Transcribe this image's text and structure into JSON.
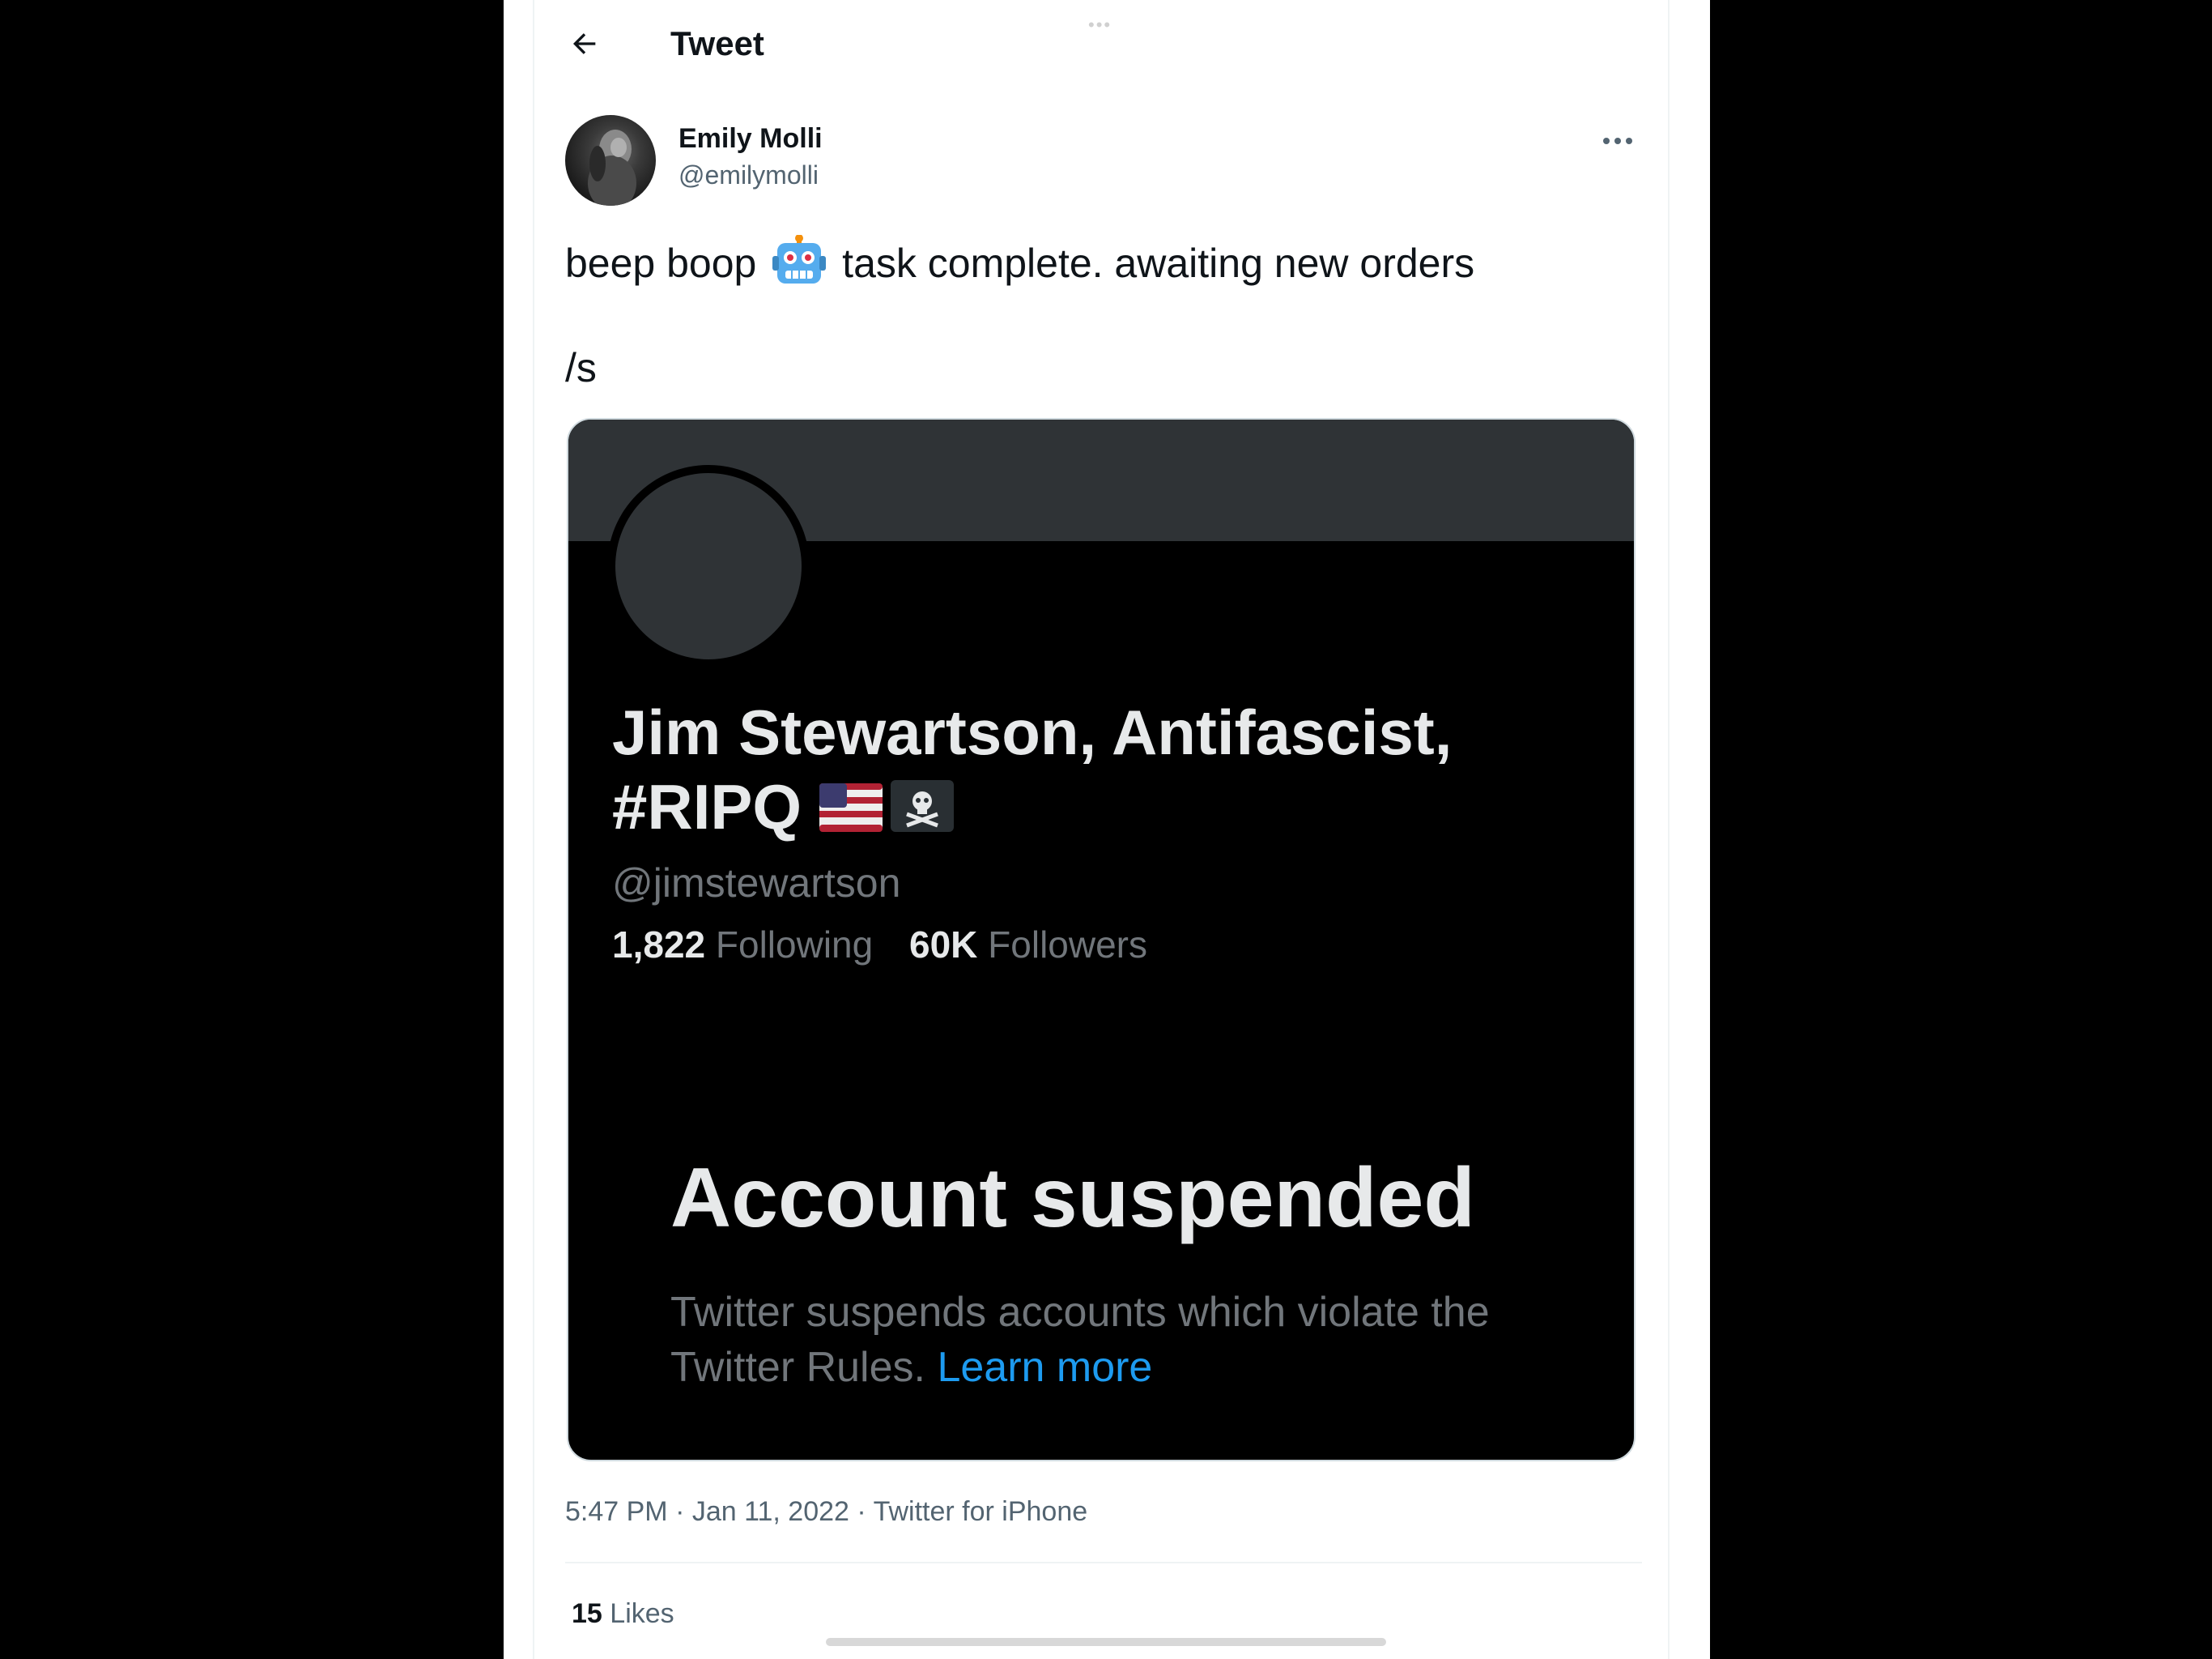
{
  "header": {
    "title": "Tweet"
  },
  "author": {
    "name": "Emily Molli",
    "handle": "@emilymolli"
  },
  "tweet": {
    "text_before_emoji": "beep boop",
    "emoji": "robot-face",
    "text_after_emoji": "task complete. awaiting new orders",
    "line2": "/s"
  },
  "media": {
    "profile_name": "Jim Stewartson, Antifascist, #RIPQ",
    "profile_emojis": [
      "us-flag",
      "pirate-flag"
    ],
    "profile_handle": "@jimstewartson",
    "following_count": "1,822",
    "following_label": "Following",
    "followers_count": "60K",
    "followers_label": "Followers",
    "suspended_title": "Account suspended",
    "suspended_desc": "Twitter suspends accounts which violate the Twitter Rules.",
    "learn_more": "Learn more"
  },
  "meta": {
    "time": "5:47 PM",
    "date": "Jan 11, 2022",
    "source": "Twitter for iPhone",
    "separator": "·"
  },
  "stats": {
    "likes_count": "15",
    "likes_label": "Likes"
  },
  "colors": {
    "text_primary": "#0f1419",
    "text_secondary": "#536471",
    "link": "#1d9bf0",
    "dark_bg": "#000000",
    "dark_banner": "#2f3336"
  }
}
